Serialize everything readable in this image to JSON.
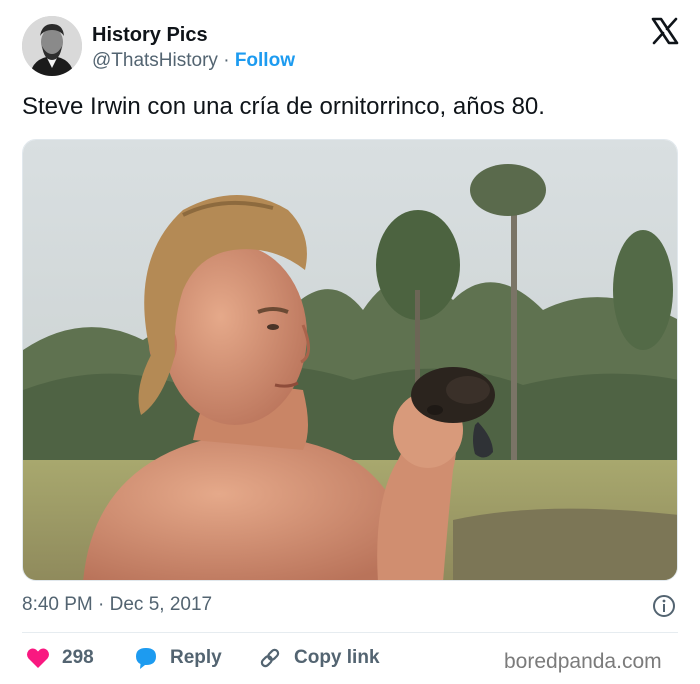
{
  "author": {
    "name": "History Pics",
    "handle": "@ThatsHistory",
    "separator": "·",
    "follow_label": "Follow"
  },
  "tweet": {
    "text": "Steve Irwin con una cría de ornitorrinco, años 80.",
    "timestamp": "8:40 PM · Dec 5, 2017"
  },
  "actions": {
    "likes_count": "298",
    "reply_label": "Reply",
    "copy_link_label": "Copy link"
  },
  "icons": {
    "brand": "x-logo-icon",
    "info": "info-icon",
    "like": "heart-icon",
    "reply": "speech-bubble-icon",
    "copy": "link-icon"
  },
  "colors": {
    "accent": "#1d9bf0",
    "like": "#f91880",
    "muted": "#536471"
  },
  "watermark": "boredpanda.com"
}
